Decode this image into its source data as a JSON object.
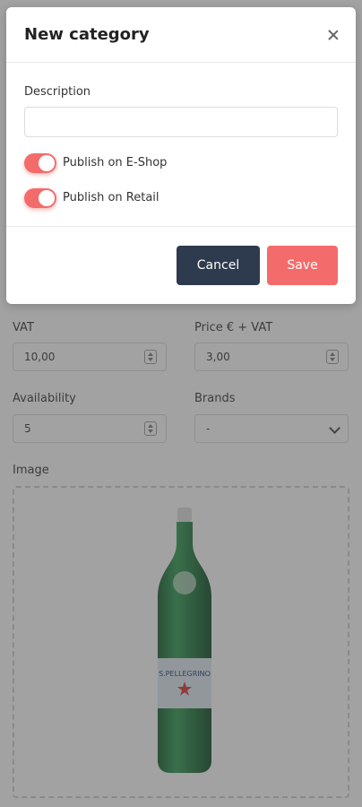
{
  "form": {
    "vat": {
      "label": "VAT",
      "value": "10,00"
    },
    "price": {
      "label": "Price € + VAT",
      "value": "3,00"
    },
    "availability": {
      "label": "Availability",
      "value": "5"
    },
    "brands": {
      "label": "Brands",
      "selected": "-"
    },
    "image": {
      "label": "Image",
      "bottle_label_text": "S.PELLEGRINO"
    }
  },
  "modal": {
    "title": "New category",
    "description": {
      "label": "Description",
      "value": "",
      "placeholder": ""
    },
    "toggles": [
      {
        "label": "Publish on E-Shop",
        "on": true
      },
      {
        "label": "Publish on Retail",
        "on": true
      }
    ],
    "cancel_label": "Cancel",
    "save_label": "Save"
  },
  "colors": {
    "accent": "#f46b6b",
    "dark_button": "#2e3a4d",
    "overlay": "rgba(70,70,70,0.5)"
  }
}
